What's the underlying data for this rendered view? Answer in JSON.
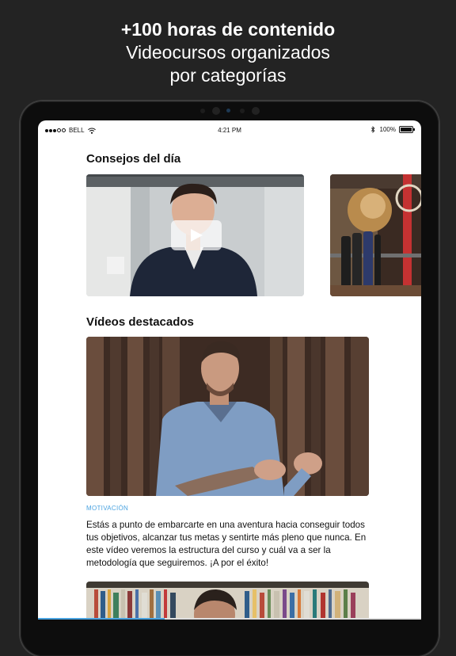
{
  "promo": {
    "headline": "+100 horas de contenido",
    "subline_1": "Videocursos organizados",
    "subline_2": "por categorías"
  },
  "status_bar": {
    "carrier": "BELL",
    "time": "4:21 PM",
    "battery": "100%",
    "signal_icon": "signal-dots-icon",
    "wifi_icon": "wifi-icon",
    "bluetooth_icon": "bluetooth-icon",
    "battery_icon": "battery-icon"
  },
  "sections": {
    "tips_title": "Consejos del día",
    "featured_title": "Vídeos destacados"
  },
  "featured_video": {
    "category": "MOTIVACIÓN",
    "description": "Estás a punto de embarcarte en una aventura hacia conseguir todos tus objetivos, alcanzar tus metas y sentirte más pleno que nunca. En este vídeo veremos la estructura del curso y cuál va a ser la metodología que seguiremos. ¡A por el éxito!"
  },
  "colors": {
    "accent": "#4aa3e0",
    "background": "#232323",
    "screen": "#ffffff"
  }
}
